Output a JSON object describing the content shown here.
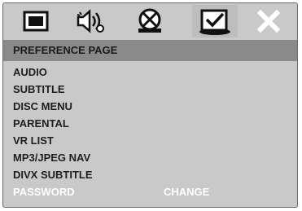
{
  "icon_tabs": [
    {
      "id": "general-setup",
      "icon": "display-window-icon",
      "selected": false
    },
    {
      "id": "audio-setup",
      "icon": "speaker-sound-icon",
      "selected": false
    },
    {
      "id": "video-setup",
      "icon": "video-reel-icon",
      "selected": false
    },
    {
      "id": "preference-setup",
      "icon": "checkmark-box-icon",
      "selected": true
    },
    {
      "id": "exit",
      "icon": "close-x-icon",
      "selected": false
    }
  ],
  "page": {
    "title": "PREFERENCE PAGE"
  },
  "menu": {
    "items": [
      {
        "label": "AUDIO"
      },
      {
        "label": "SUBTITLE"
      },
      {
        "label": "DISC MENU"
      },
      {
        "label": "PARENTAL"
      },
      {
        "label": "VR LIST"
      },
      {
        "label": "MP3/JPEG NAV"
      },
      {
        "label": "DIVX SUBTITLE"
      },
      {
        "label": "PASSWORD",
        "highlighted": true,
        "value": "CHANGE"
      }
    ]
  },
  "colors": {
    "panel": "#c9c9c9",
    "header_bar": "#8a8a8a",
    "text": "#1e1e1e",
    "highlight_text": "#ffffff"
  }
}
